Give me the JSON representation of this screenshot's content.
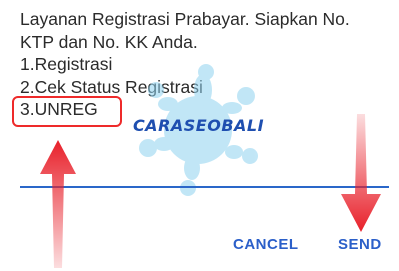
{
  "dialog": {
    "message_lines": [
      "Layanan Registrasi Prabayar. Siapkan No.",
      "KTP dan No. KK Anda.",
      "1.Registrasi",
      "2.Cek Status Registrasi",
      "3.UNREG"
    ],
    "input_value": ""
  },
  "buttons": {
    "cancel_label": "CANCEL",
    "send_label": "SEND"
  },
  "watermark": {
    "text": "CARASEOBALI"
  },
  "colors": {
    "accent": "#2b5fc9",
    "annotation_red": "#ee2a2a",
    "watermark_splash": "#8fd3f0"
  }
}
